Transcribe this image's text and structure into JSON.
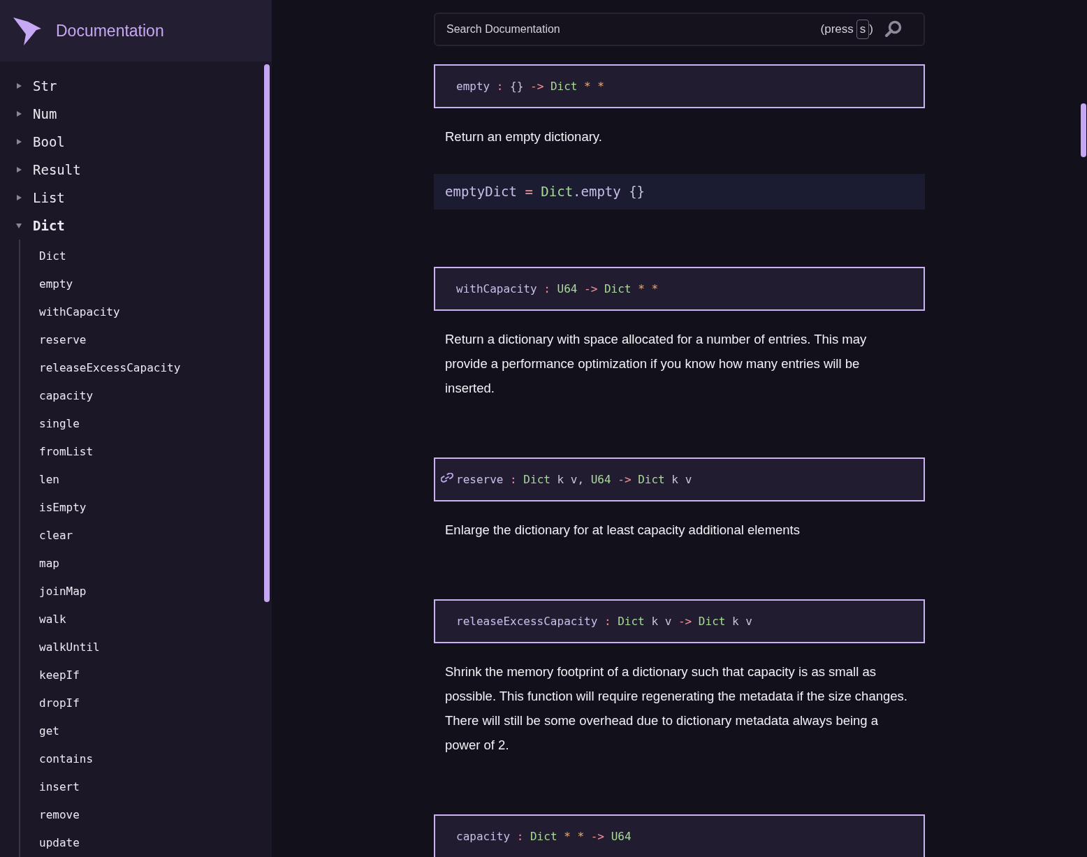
{
  "header": {
    "title": "Documentation"
  },
  "sidebar": {
    "modules": [
      {
        "name": "Str",
        "expanded": false
      },
      {
        "name": "Num",
        "expanded": false
      },
      {
        "name": "Bool",
        "expanded": false
      },
      {
        "name": "Result",
        "expanded": false
      },
      {
        "name": "List",
        "expanded": false
      },
      {
        "name": "Dict",
        "expanded": true,
        "children": [
          "Dict",
          "empty",
          "withCapacity",
          "reserve",
          "releaseExcessCapacity",
          "capacity",
          "single",
          "fromList",
          "len",
          "isEmpty",
          "clear",
          "map",
          "joinMap",
          "walk",
          "walkUntil",
          "keepIf",
          "dropIf",
          "get",
          "contains",
          "insert",
          "remove",
          "update"
        ]
      }
    ]
  },
  "search": {
    "placeholder": "Search Documentation",
    "hint_prefix": "(press",
    "hint_key": "s",
    "hint_suffix": ")"
  },
  "entries": [
    {
      "link_icon": false,
      "signature": [
        {
          "kind": "name",
          "text": "empty"
        },
        {
          "kind": "op",
          "text": ":"
        },
        {
          "kind": "plain",
          "text": "{}"
        },
        {
          "kind": "op",
          "text": "->"
        },
        {
          "kind": "type",
          "text": "Dict"
        },
        {
          "kind": "wild",
          "text": "*"
        },
        {
          "kind": "wild",
          "text": "*"
        }
      ],
      "description": "Return an empty dictionary.",
      "example": [
        {
          "kind": "name",
          "text": "emptyDict"
        },
        {
          "kind": "op",
          "text": "="
        },
        {
          "kind": "type",
          "text": "Dict"
        },
        {
          "kind": "joined",
          "text": ".empty"
        },
        {
          "kind": "plain",
          "text": "{}"
        }
      ]
    },
    {
      "link_icon": false,
      "signature": [
        {
          "kind": "name",
          "text": "withCapacity"
        },
        {
          "kind": "op",
          "text": ":"
        },
        {
          "kind": "type",
          "text": "U64"
        },
        {
          "kind": "op",
          "text": "->"
        },
        {
          "kind": "type",
          "text": "Dict"
        },
        {
          "kind": "wild",
          "text": "*"
        },
        {
          "kind": "wild",
          "text": "*"
        }
      ],
      "description": "Return a dictionary with space allocated for a number of entries. This may provide a performance optimization if you know how many entries will be inserted."
    },
    {
      "link_icon": true,
      "signature": [
        {
          "kind": "name",
          "text": "reserve"
        },
        {
          "kind": "op",
          "text": ":"
        },
        {
          "kind": "type",
          "text": "Dict"
        },
        {
          "kind": "plain",
          "text": "k"
        },
        {
          "kind": "plain",
          "text": "v,"
        },
        {
          "kind": "type",
          "text": "U64"
        },
        {
          "kind": "op",
          "text": "->"
        },
        {
          "kind": "type",
          "text": "Dict"
        },
        {
          "kind": "plain",
          "text": "k"
        },
        {
          "kind": "plain",
          "text": "v"
        }
      ],
      "description": "Enlarge the dictionary for at least capacity additional elements"
    },
    {
      "link_icon": false,
      "signature": [
        {
          "kind": "name",
          "text": "releaseExcessCapacity"
        },
        {
          "kind": "op",
          "text": ":"
        },
        {
          "kind": "type",
          "text": "Dict"
        },
        {
          "kind": "plain",
          "text": "k"
        },
        {
          "kind": "plain",
          "text": "v"
        },
        {
          "kind": "op",
          "text": "->"
        },
        {
          "kind": "type",
          "text": "Dict"
        },
        {
          "kind": "plain",
          "text": "k"
        },
        {
          "kind": "plain",
          "text": "v"
        }
      ],
      "description": "Shrink the memory footprint of a dictionary such that capacity is as small as possible. This function will require regenerating the metadata if the size changes. There will still be some overhead due to dictionary metadata always being a power of 2."
    },
    {
      "link_icon": false,
      "signature": [
        {
          "kind": "name",
          "text": "capacity"
        },
        {
          "kind": "op",
          "text": ":"
        },
        {
          "kind": "type",
          "text": "Dict"
        },
        {
          "kind": "wild",
          "text": "*"
        },
        {
          "kind": "wild",
          "text": "*"
        },
        {
          "kind": "op",
          "text": "->"
        },
        {
          "kind": "type",
          "text": "U64"
        }
      ]
    }
  ]
}
